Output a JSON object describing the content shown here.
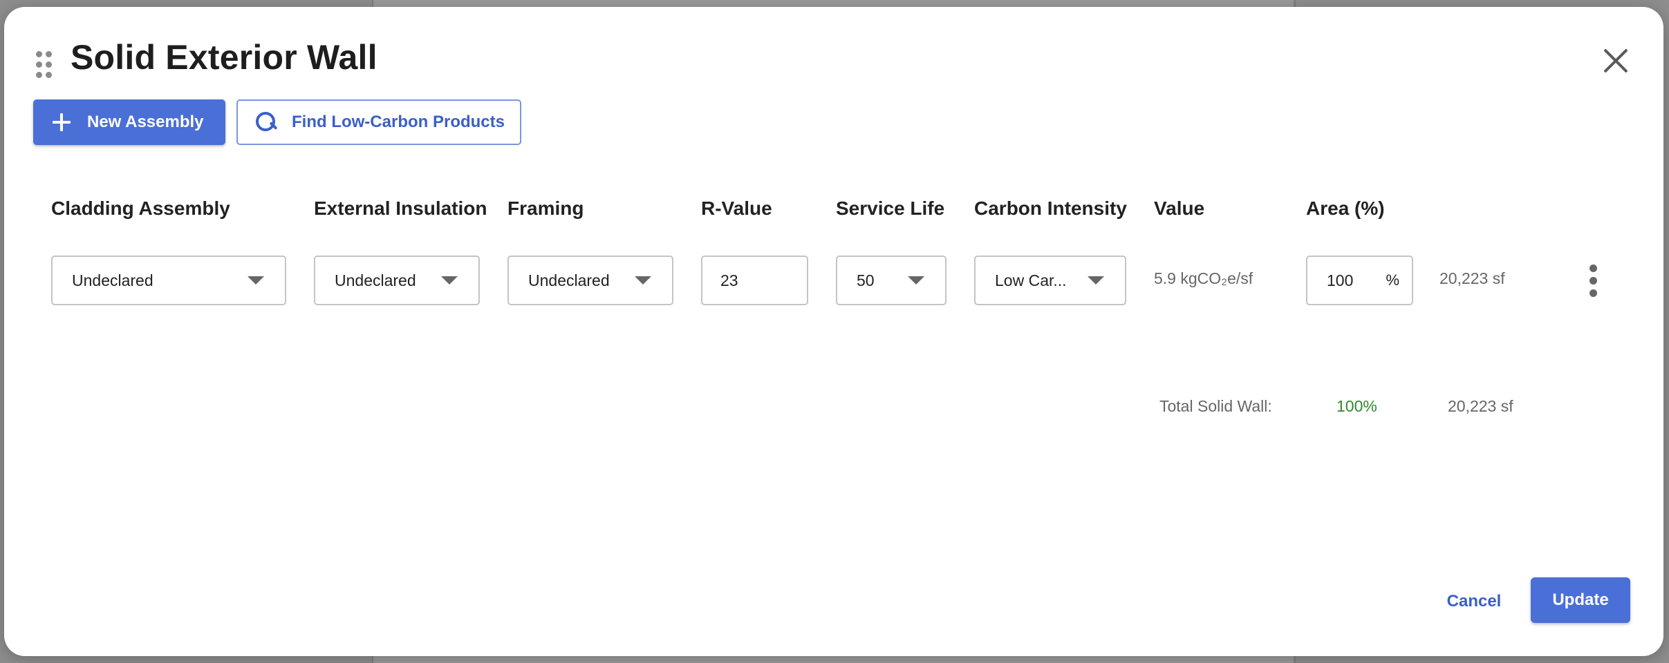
{
  "modal": {
    "title": "Solid Exterior Wall",
    "new_assembly_label": "New Assembly",
    "find_products_label": "Find Low-Carbon Products",
    "cancel_label": "Cancel",
    "update_label": "Update"
  },
  "columns": [
    "Cladding Assembly",
    "External Insulation",
    "Framing",
    "R-Value",
    "Service Life",
    "Carbon Intensity",
    "Value",
    "Area (%)"
  ],
  "row": {
    "cladding": "Undeclared",
    "insulation": "Undeclared",
    "framing": "Undeclared",
    "r_value": "23",
    "service_life": "50",
    "carbon_intensity": "Low Car...",
    "value": "5.9 kgCO₂e/sf",
    "area_percent": "100",
    "area_unit": "%",
    "area_sf": "20,223 sf"
  },
  "total": {
    "label": "Total Solid Wall:",
    "percent": "100%",
    "area": "20,223 sf"
  },
  "colors": {
    "accent": "#4a6fd6",
    "success": "#2d8a2d"
  }
}
